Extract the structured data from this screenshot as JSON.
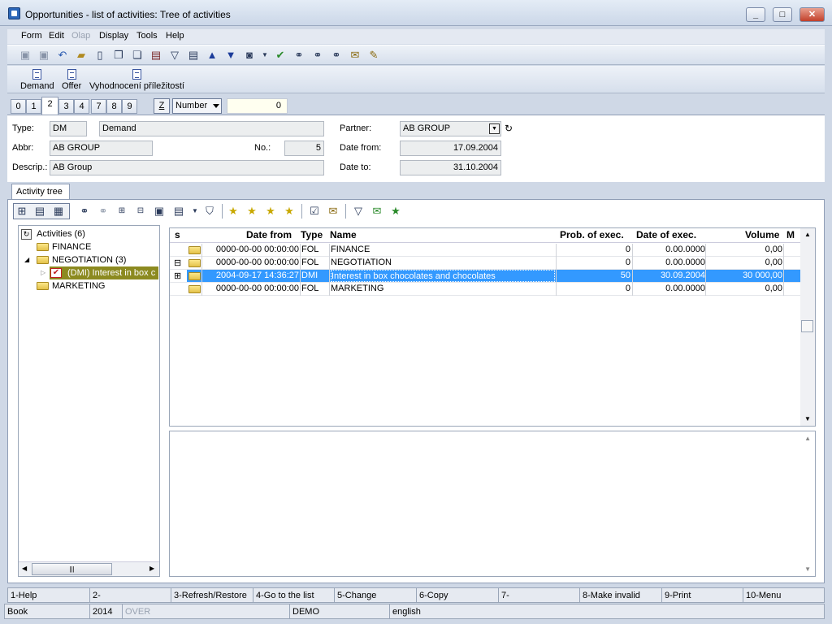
{
  "window": {
    "title": "Opportunities - list of activities: Tree of activities",
    "min": "_",
    "max": "□",
    "close": "✕"
  },
  "menu": [
    "Form",
    "Edit",
    "Olap",
    "Display",
    "Tools",
    "Help"
  ],
  "big_buttons": [
    "Demand",
    "Offer",
    "Vyhodnocení příležitostí"
  ],
  "tabs": [
    "0",
    "1",
    "2",
    "3",
    "4",
    "7",
    "8",
    "9"
  ],
  "active_tab": "2",
  "z_label": "Z",
  "sort_select": "Number",
  "number_value": "0",
  "form": {
    "type_label": "Type:",
    "type_code": "DM",
    "type_name": "Demand",
    "abbr_label": "Abbr:",
    "abbr": "AB GROUP",
    "no_label": "No.:",
    "no": "5",
    "descr_label": "Descrip.:",
    "descr": "AB Group",
    "partner_label": "Partner:",
    "partner": "AB GROUP",
    "date_from_label": "Date from:",
    "date_from": "17.09.2004",
    "date_to_label": "Date to:",
    "date_to": "31.10.2004"
  },
  "activity_tab": "Activity tree",
  "tree": {
    "root": "Activities (6)",
    "items": [
      "FINANCE",
      "NEGOTIATION (3)",
      "(DMI) Interest in box c",
      "MARKETING"
    ]
  },
  "grid": {
    "headers": [
      "s",
      "Date from",
      "Type",
      "Name",
      "Prob. of exec.",
      "Date of exec.",
      "Volume",
      "M"
    ],
    "rows": [
      {
        "exp": "",
        "date": "0000-00-00 00:00:00",
        "type": "FOL",
        "name": "FINANCE",
        "prob": "0",
        "exec": "0.00.0000",
        "vol": "0,00"
      },
      {
        "exp": "⊟",
        "date": "0000-00-00 00:00:00",
        "type": "FOL",
        "name": "NEGOTIATION",
        "prob": "0",
        "exec": "0.00.0000",
        "vol": "0,00"
      },
      {
        "exp": "⊞",
        "date": "2004-09-17 14:36:27",
        "type": "DMI",
        "name": "Interest in box chocolates and chocolates",
        "prob": "50",
        "exec": "30.09.2004",
        "vol": "30 000,00"
      },
      {
        "exp": "",
        "date": "0000-00-00 00:00:00",
        "type": "FOL",
        "name": "MARKETING",
        "prob": "0",
        "exec": "0.00.0000",
        "vol": "0,00"
      }
    ]
  },
  "fkeys": [
    "1-Help",
    "2-",
    "3-Refresh/Restore",
    "4-Go to the list",
    "5-Change",
    "6-Copy",
    "7-",
    "8-Make invalid",
    "9-Print",
    "10-Menu"
  ],
  "status": {
    "book": "Book",
    "year": "2014",
    "over": "OVER",
    "db": "DEMO",
    "lang": "english"
  },
  "icons": [
    "save-icon",
    "save-as-icon",
    "undo-icon",
    "open-folder-icon",
    "new-doc-icon",
    "copy-icon",
    "paste-icon",
    "book-icon",
    "filter-icon",
    "filter-doc-icon",
    "arrow-up-icon",
    "arrow-down-icon",
    "camera-icon",
    "arrow-check-icon",
    "binoculars-icon",
    "binoculars-next-icon",
    "binoculars-prev-icon",
    "mail-icon",
    "edit-icon"
  ]
}
